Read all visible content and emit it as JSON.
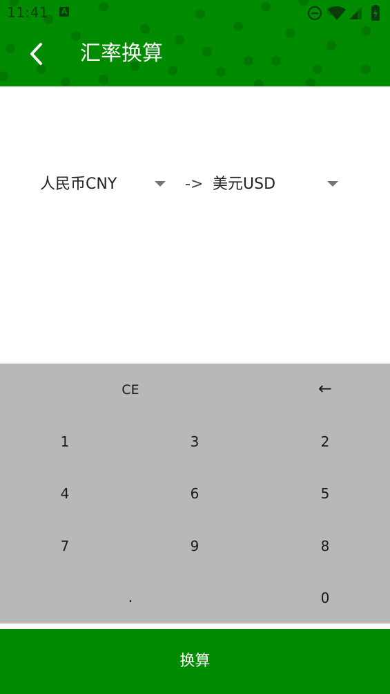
{
  "status_bar": {
    "time": "11:41",
    "notification_icon": "a-icon",
    "icons": [
      "do-not-disturb-icon",
      "wifi-icon",
      "signal-icon",
      "battery-charging-icon"
    ]
  },
  "toolbar": {
    "back_icon": "chevron-left-icon",
    "title": "汇率换算"
  },
  "converter": {
    "from_currency": "人民币CNY",
    "arrow": "->",
    "to_currency": "美元USD"
  },
  "keypad": {
    "clear": "CE",
    "backspace": "←",
    "rows": [
      [
        "1",
        "3",
        "2"
      ],
      [
        "4",
        "6",
        "5"
      ],
      [
        "7",
        "9",
        "8"
      ]
    ],
    "dot": ".",
    "zero": "0"
  },
  "actions": {
    "convert_label": "换算"
  },
  "colors": {
    "primary": "#008b00",
    "dots": "#007500",
    "keypad_bg": "#b8b8b8",
    "status_text": "#0b3d0b"
  }
}
